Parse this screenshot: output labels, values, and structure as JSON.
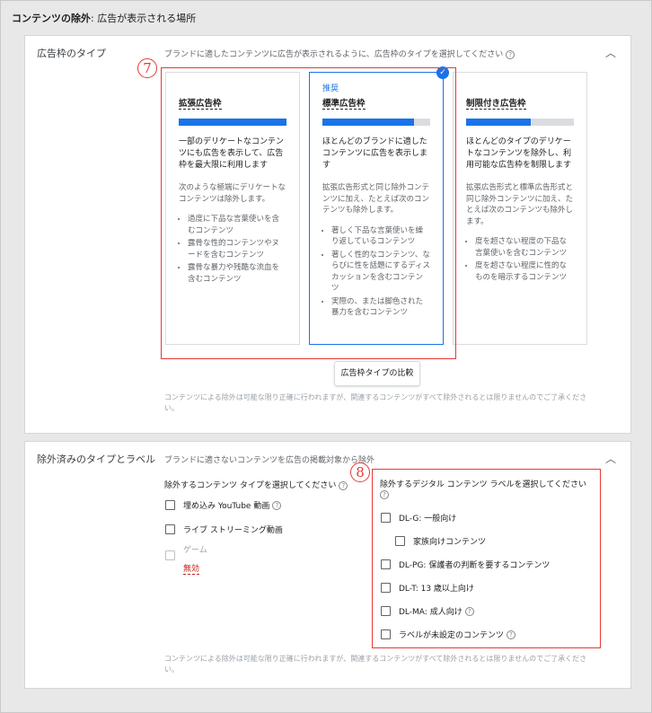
{
  "header": {
    "title_bold": "コンテンツの除外",
    "title_rest": ": 広告が表示される場所"
  },
  "inventory": {
    "title": "広告枠のタイプ",
    "description": "ブランドに適したコンテンツに広告が表示されるように、広告枠のタイプを選択してください",
    "annotation_number": "7",
    "compare_button": "広告枠タイプの比較",
    "note": "コンテンツによる除外は可能な限り正確に行われますが、関連するコンテンツがすべて除外されるとは限りませんのでご了承ください。",
    "tiles": [
      {
        "recommended": "",
        "name": "拡張広告枠",
        "level": 1.0,
        "summary": "一部のデリケートなコンテンツにも広告を表示して、広告枠を最大限に利用します",
        "detail": "次のような極端にデリケートなコンテンツは除外します。",
        "bullets": [
          "過度に下品な言葉使いを含むコンテンツ",
          "露骨な性的コンテンツやヌードを含むコンテンツ",
          "露骨な暴力や残酷な流血を含むコンテンツ"
        ],
        "selected": false
      },
      {
        "recommended": "推奨",
        "name": "標準広告枠",
        "level": 0.85,
        "summary": "ほとんどのブランドに適したコンテンツに広告を表示します",
        "detail": "拡張広告形式と同じ除外コンテンツに加え、たとえば次のコンテンツも除外します。",
        "bullets": [
          "著しく下品な言葉使いを繰り返しているコンテンツ",
          "著しく性的なコンテンツ、ならびに性を話題にするディスカッションを含むコンテンツ",
          "実際の、または脚色された暴力を含むコンテンツ"
        ],
        "selected": true
      },
      {
        "recommended": "",
        "name": "制限付き広告枠",
        "level": 0.6,
        "summary": "ほとんどのタイプのデリケートなコンテンツを除外し、利用可能な広告枠を制限します",
        "detail": "拡張広告形式と標準広告形式と同じ除外コンテンツに加え、たとえば次のコンテンツも除外します。",
        "bullets": [
          "度を超さない程度の下品な言葉使いを含むコンテンツ",
          "度を超さない程度に性的なものを暗示するコンテンツ"
        ],
        "selected": false
      }
    ]
  },
  "excluded": {
    "title": "除外済みのタイプとラベル",
    "description": "ブランドに適さないコンテンツを広告の掲載対象から除外",
    "annotation_number": "8",
    "types_heading": "除外するコンテンツ タイプを選択してください",
    "types": [
      {
        "label": "埋め込み YouTube 動画",
        "help": true,
        "disabled": false
      },
      {
        "label": "ライブ ストリーミング動画",
        "help": false,
        "disabled": false
      },
      {
        "label": "ゲーム",
        "help": false,
        "disabled": true
      }
    ],
    "game_invalid": "無効",
    "labels_heading": "除外するデジタル コンテンツ ラベルを選択してください",
    "labels": [
      {
        "label": "DL-G: 一般向け",
        "help": false
      },
      {
        "label": "家族向けコンテンツ",
        "help": false
      },
      {
        "label": "DL-PG: 保護者の判断を要するコンテンツ",
        "help": false
      },
      {
        "label": "DL-T: 13 歳以上向け",
        "help": false
      },
      {
        "label": "DL-MA: 成人向け",
        "help": true
      },
      {
        "label": "ラベルが未設定のコンテンツ",
        "help": true
      }
    ],
    "note": "コンテンツによる除外は可能な限り正確に行われますが、関連するコンテンツがすべて除外されるとは限りませんのでご了承ください。"
  },
  "icons": {
    "chevron": "chevron-up-icon",
    "help": "help-icon",
    "check": "check-circle-icon"
  },
  "colors": {
    "accent": "#1a73e8",
    "annotation": "#e53935",
    "invalid": "#c5221f"
  }
}
